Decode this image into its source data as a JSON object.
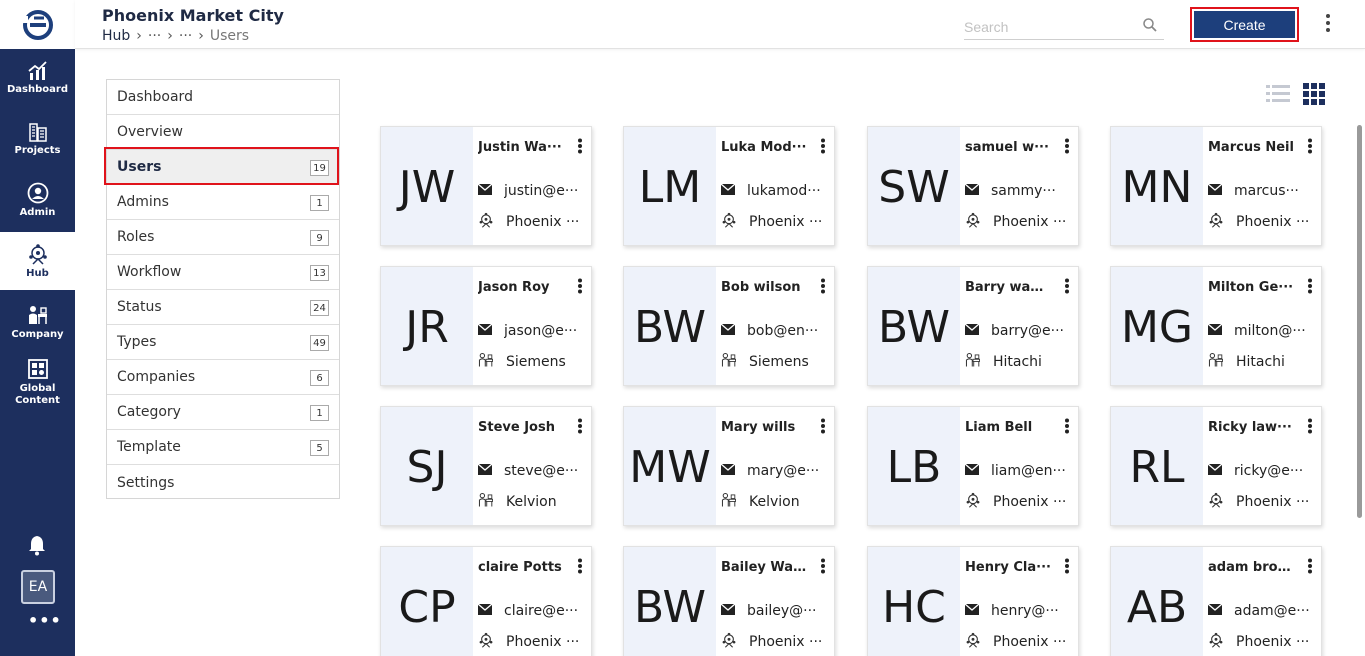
{
  "rail": {
    "items": [
      {
        "label": "Dashboard",
        "icon": "chart-up-icon"
      },
      {
        "label": "Projects",
        "icon": "buildings-icon"
      },
      {
        "label": "Admin",
        "icon": "admin-user-icon"
      },
      {
        "label": "Hub",
        "icon": "hub-icon"
      },
      {
        "label": "Company",
        "icon": "company-icon"
      },
      {
        "label": "Global Content",
        "icon": "global-content-icon"
      }
    ],
    "avatar": "EA",
    "more": "•••"
  },
  "header": {
    "title": "Phoenix Market City",
    "breadcrumb": {
      "hub": "Hub",
      "sep": "›",
      "ell1": "···",
      "ell2": "···",
      "current": "Users"
    },
    "search_placeholder": "Search",
    "create_label": "Create"
  },
  "menu": {
    "items": [
      {
        "label": "Dashboard",
        "count": ""
      },
      {
        "label": "Overview",
        "count": ""
      },
      {
        "label": "Users",
        "count": "19"
      },
      {
        "label": "Admins",
        "count": "1"
      },
      {
        "label": "Roles",
        "count": "9"
      },
      {
        "label": "Workflow",
        "count": "13"
      },
      {
        "label": "Status",
        "count": "24"
      },
      {
        "label": "Types",
        "count": "49"
      },
      {
        "label": "Companies",
        "count": "6"
      },
      {
        "label": "Category",
        "count": "1"
      },
      {
        "label": "Template",
        "count": "5"
      },
      {
        "label": "Settings",
        "count": ""
      }
    ]
  },
  "cards": [
    {
      "initials": "JW",
      "name": "Justin Wa···",
      "email": "justin@e···",
      "org": "Phoenix ···",
      "org_icon": "hub-icon"
    },
    {
      "initials": "LM",
      "name": "Luka Mod···",
      "email": "lukamod···",
      "org": "Phoenix ···",
      "org_icon": "hub-icon"
    },
    {
      "initials": "SW",
      "name": "samuel w···",
      "email": "sammy···",
      "org": "Phoenix ···",
      "org_icon": "hub-icon"
    },
    {
      "initials": "MN",
      "name": "Marcus Neil",
      "email": "marcus···",
      "org": "Phoenix ···",
      "org_icon": "hub-icon"
    },
    {
      "initials": "JR",
      "name": "Jason Roy",
      "email": "jason@e···",
      "org": "Siemens",
      "org_icon": "company-icon"
    },
    {
      "initials": "BW",
      "name": "Bob wilson",
      "email": "bob@en···",
      "org": "Siemens",
      "org_icon": "company-icon"
    },
    {
      "initials": "BW",
      "name": "Barry was···",
      "email": "barry@e···",
      "org": "Hitachi",
      "org_icon": "company-icon"
    },
    {
      "initials": "MG",
      "name": "Milton Ge···",
      "email": "milton@···",
      "org": "Hitachi",
      "org_icon": "company-icon"
    },
    {
      "initials": "SJ",
      "name": "Steve Josh",
      "email": "steve@e···",
      "org": "Kelvion",
      "org_icon": "company-icon"
    },
    {
      "initials": "MW",
      "name": "Mary wills",
      "email": "mary@e···",
      "org": "Kelvion",
      "org_icon": "company-icon"
    },
    {
      "initials": "LB",
      "name": "Liam Bell",
      "email": "liam@en···",
      "org": "Phoenix ···",
      "org_icon": "hub-icon"
    },
    {
      "initials": "RL",
      "name": "Ricky law···",
      "email": "ricky@e···",
      "org": "Phoenix ···",
      "org_icon": "hub-icon"
    },
    {
      "initials": "CP",
      "name": "claire Potts",
      "email": "claire@e···",
      "org": "Phoenix ···",
      "org_icon": "hub-icon"
    },
    {
      "initials": "BW",
      "name": "Bailey Wa···",
      "email": "bailey@···",
      "org": "Phoenix ···",
      "org_icon": "hub-icon"
    },
    {
      "initials": "HC",
      "name": "Henry Cla···",
      "email": "henry@···",
      "org": "Phoenix ···",
      "org_icon": "hub-icon"
    },
    {
      "initials": "AB",
      "name": "adam brogg",
      "email": "adam@e···",
      "org": "Phoenix ···",
      "org_icon": "hub-icon"
    }
  ],
  "colors": {
    "rail": "#1d2f5e",
    "primary_button": "#1d3f7c",
    "highlight": "#e0131b",
    "card_initials_bg": "#eef2fa"
  }
}
